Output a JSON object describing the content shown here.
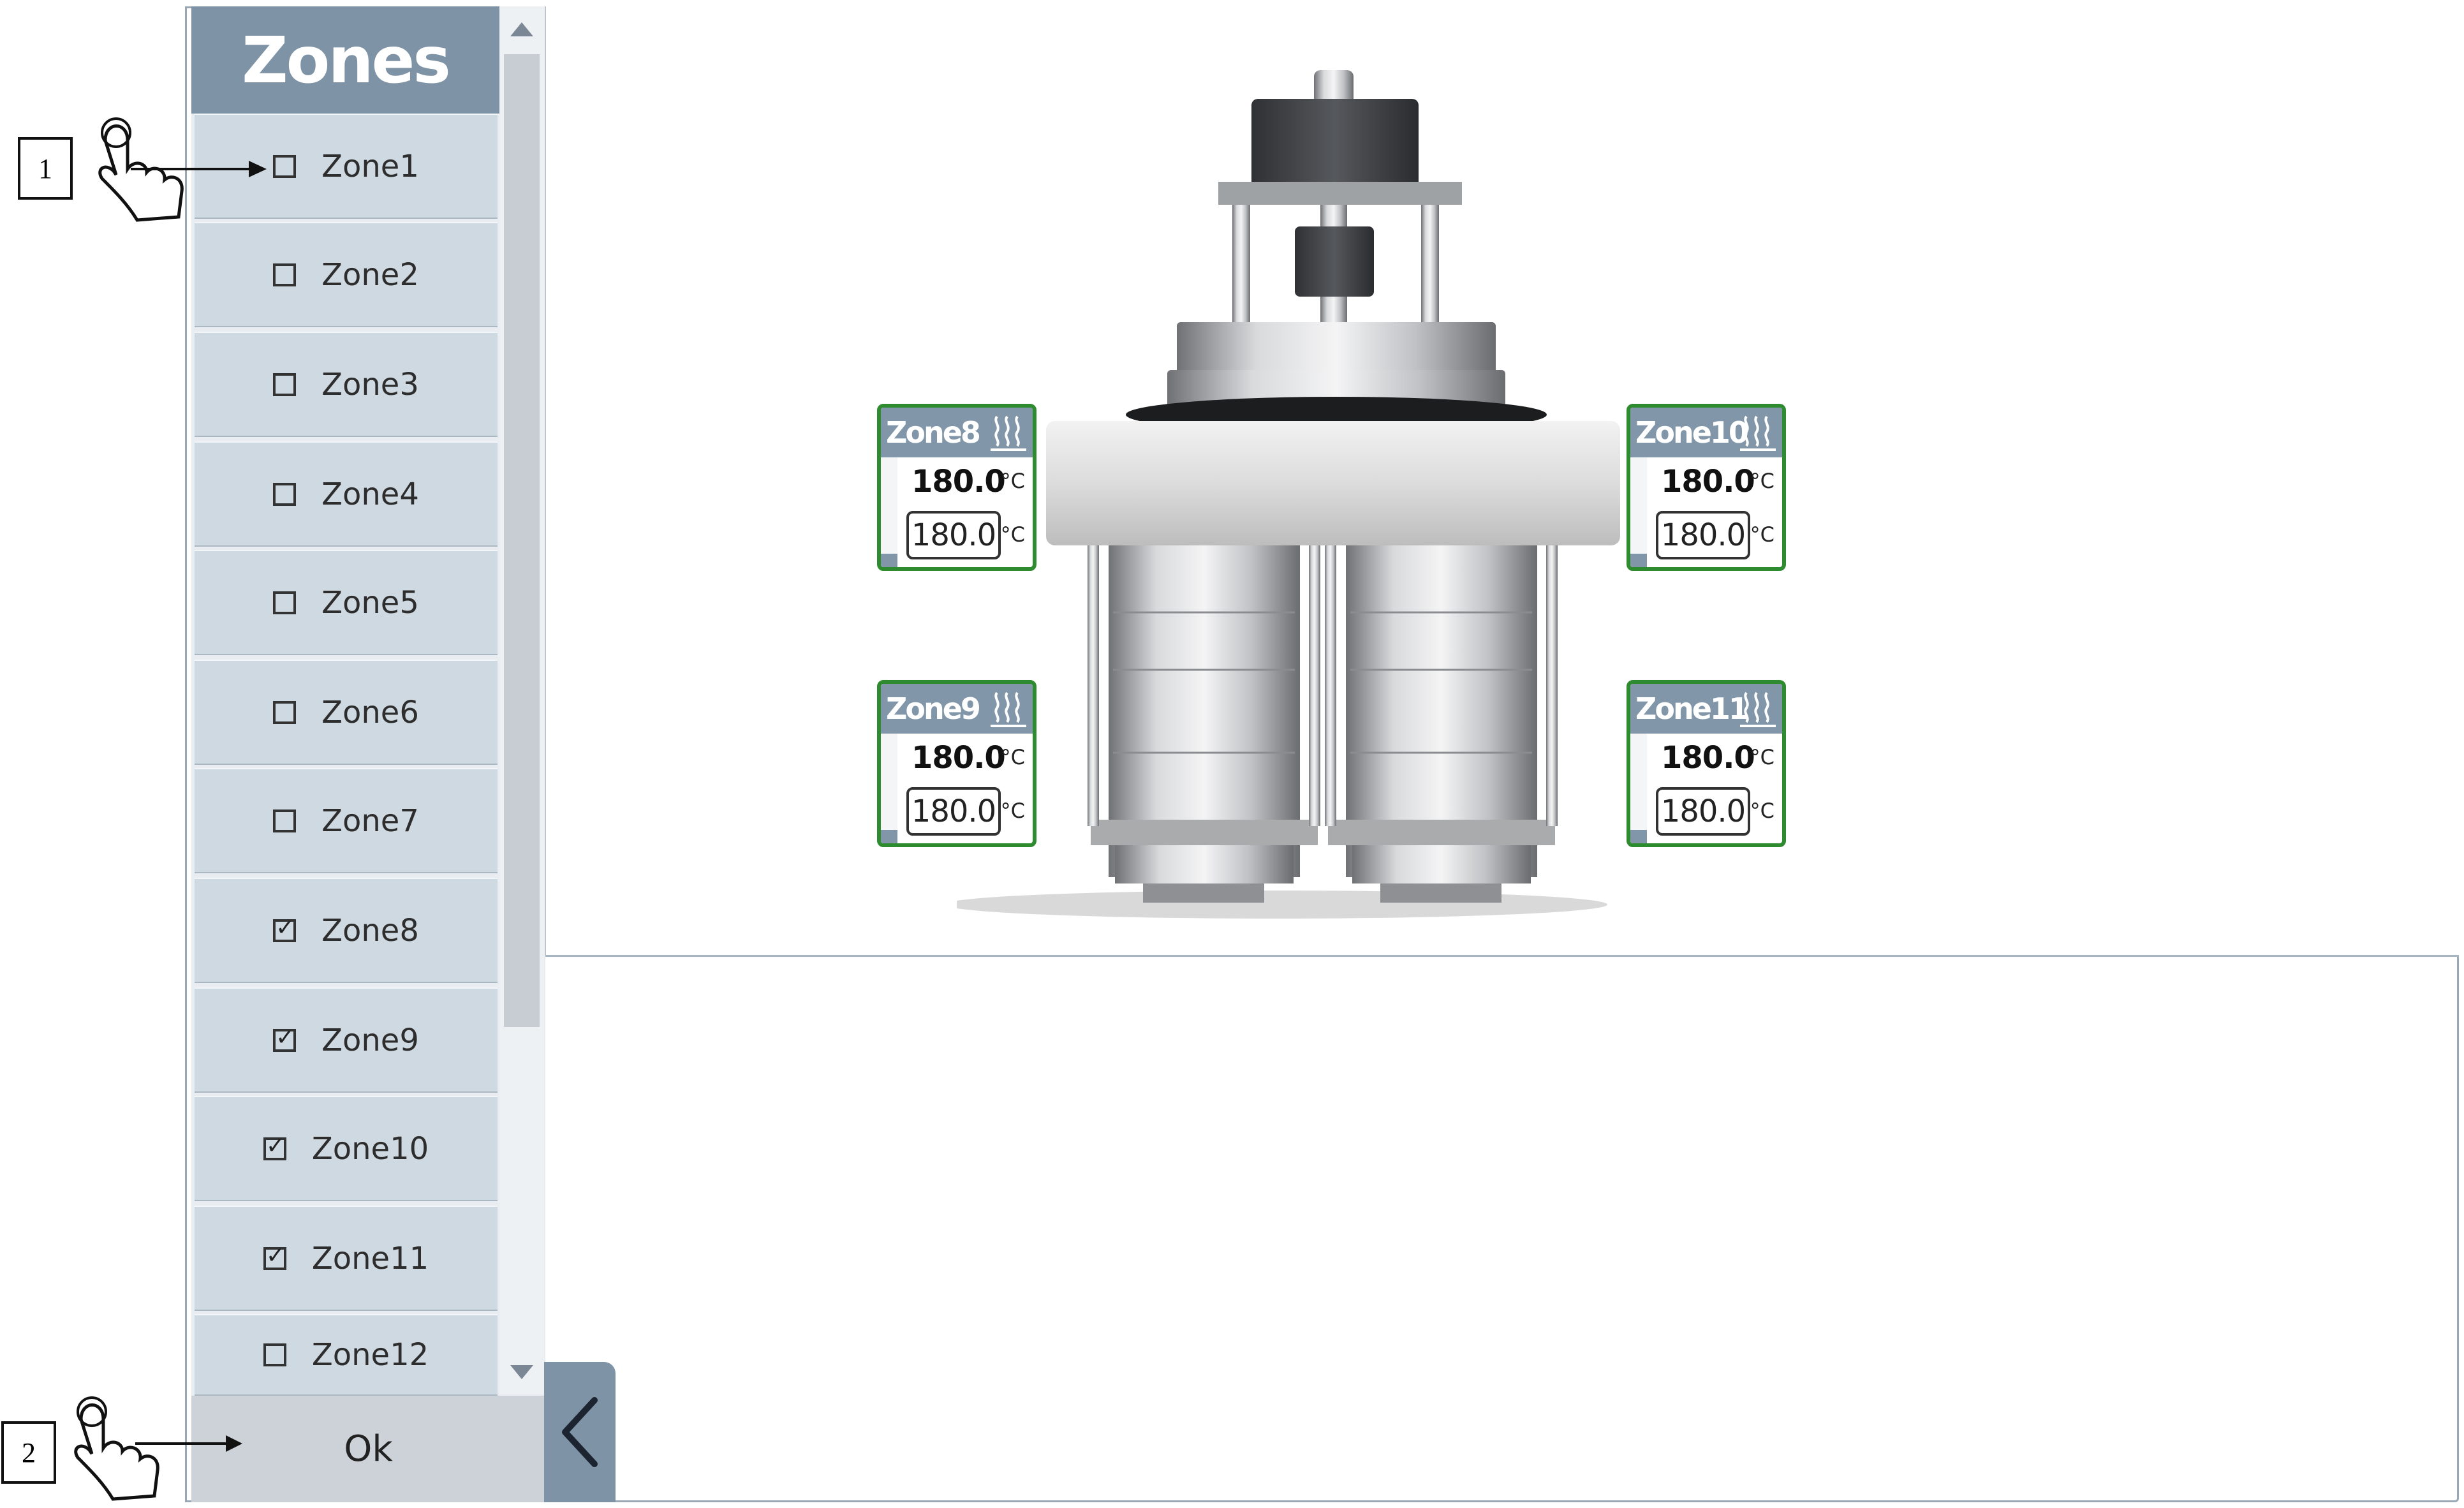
{
  "zones_panel": {
    "title": "Zones",
    "items": [
      {
        "label": "Zone1",
        "checked": false
      },
      {
        "label": "Zone2",
        "checked": false
      },
      {
        "label": "Zone3",
        "checked": false
      },
      {
        "label": "Zone4",
        "checked": false
      },
      {
        "label": "Zone5",
        "checked": false
      },
      {
        "label": "Zone6",
        "checked": false
      },
      {
        "label": "Zone7",
        "checked": false
      },
      {
        "label": "Zone8",
        "checked": true
      },
      {
        "label": "Zone9",
        "checked": true
      },
      {
        "label": "Zone10",
        "checked": true
      },
      {
        "label": "Zone11",
        "checked": true
      },
      {
        "label": "Zone12",
        "checked": false
      }
    ],
    "ok_label": "Ok"
  },
  "callouts": [
    {
      "number": "1"
    },
    {
      "number": "2"
    }
  ],
  "widgets": [
    {
      "name": "Zone8",
      "actual": "180.0",
      "setpoint": "180.0",
      "unit": "°C",
      "level": 0.12
    },
    {
      "name": "Zone10",
      "actual": "180.0",
      "setpoint": "180.0",
      "unit": "°C",
      "level": 0.12
    },
    {
      "name": "Zone9",
      "actual": "180.0",
      "setpoint": "180.0",
      "unit": "°C",
      "level": 0.12
    },
    {
      "name": "Zone11",
      "actual": "180.0",
      "setpoint": "180.0",
      "unit": "°C",
      "level": 0.12
    }
  ],
  "colors": {
    "header": "#7f93a6",
    "zone_item": "#cfd9e1",
    "widget_border": "#2f8b2f"
  },
  "icons": {
    "heater": "heater-icon",
    "pointer": "hand-pointer-icon",
    "collapse": "chevron-left-icon"
  }
}
